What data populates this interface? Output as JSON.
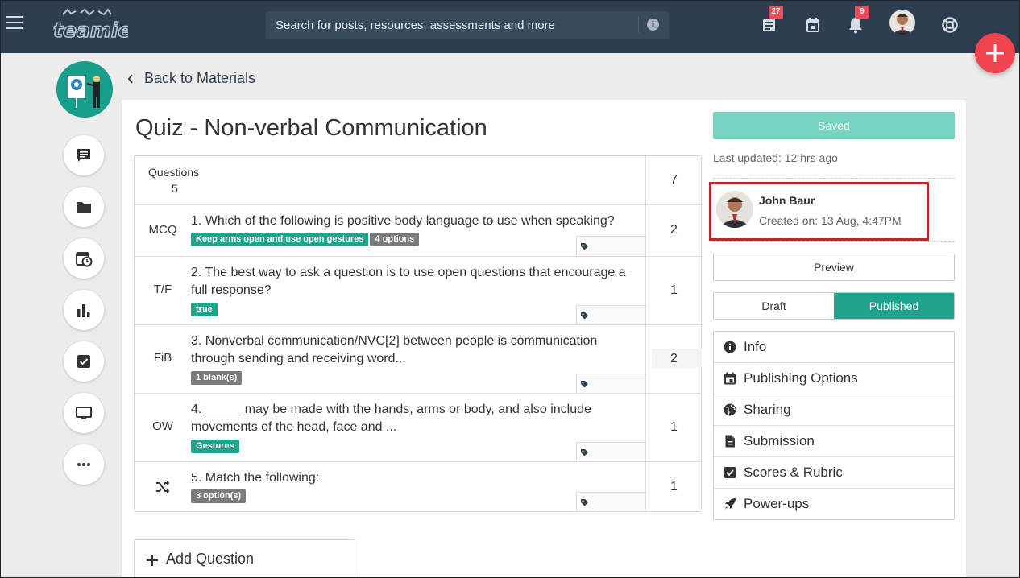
{
  "app": {
    "name": "teamie"
  },
  "topbar": {
    "search_placeholder": "Search for posts, resources, assessments and more",
    "info_glyph": "i",
    "newsfeed_badge": "27",
    "notifications_badge": "9",
    "icons": [
      "menu-icon",
      "newsfeed-icon",
      "calendar-icon",
      "bell-icon",
      "help-icon"
    ]
  },
  "nav": {
    "back_label": "Back to Materials"
  },
  "rail": {
    "items": [
      "discussions-icon",
      "folder-icon",
      "schedule-icon",
      "analytics-icon",
      "assessment-icon",
      "display-icon",
      "more-icon"
    ]
  },
  "quiz": {
    "title": "Quiz - Non-verbal Communication",
    "header": {
      "label": "Questions",
      "count": "5",
      "total_score": "7"
    },
    "questions": [
      {
        "type": "MCQ",
        "text": "1. Which of the following is positive body language to use when speaking?",
        "tags": [
          {
            "text": "Keep arms open and use open gestures",
            "color": "#1fa38c"
          },
          {
            "text": "4 options",
            "color": "#7a7a7a"
          }
        ],
        "score": "2"
      },
      {
        "type": "T/F",
        "text": "2. The best way to ask a question is to use open questions that encourage a full response?",
        "tags": [
          {
            "text": "true",
            "color": "#1fa38c"
          }
        ],
        "score": "1"
      },
      {
        "type": "FiB",
        "text": "3. Nonverbal communication/NVC[2] between people is communication through sending and receiving word...",
        "tags": [
          {
            "text": "1 blank(s)",
            "color": "#7a7a7a"
          }
        ],
        "score": "2"
      },
      {
        "type": "OW",
        "text": "4. _____ may be made with the hands, arms or body, and also include movements of the head, face and ...",
        "tags": [
          {
            "text": "Gestures",
            "color": "#1fa38c"
          }
        ],
        "score": "1"
      },
      {
        "type": "shuffle-icon",
        "text": "5. Match the following:",
        "tags": [
          {
            "text": "3 option(s)",
            "color": "#7a7a7a"
          }
        ],
        "score": "1"
      }
    ],
    "add_question": "Add Question"
  },
  "sidebar": {
    "saved_label": "Saved",
    "last_updated": "Last updated: 12 hrs ago",
    "author": {
      "name": "John Baur",
      "created": "Created on: 13 Aug, 4:47PM"
    },
    "preview_label": "Preview",
    "status": {
      "draft": "Draft",
      "published": "Published",
      "selected": "Published"
    },
    "menu": [
      {
        "label": "Info",
        "icon": "info-icon"
      },
      {
        "label": "Publishing Options",
        "icon": "calendar-icon"
      },
      {
        "label": "Sharing",
        "icon": "globe-icon"
      },
      {
        "label": "Submission",
        "icon": "document-icon"
      },
      {
        "label": "Scores & Rubric",
        "icon": "checkbox-icon"
      },
      {
        "label": "Power-ups",
        "icon": "rocket-icon"
      }
    ]
  },
  "colors": {
    "topbar": "#2c3e50",
    "accent": "#1fa38c",
    "saved": "#77d4c0",
    "fab": "#f0454f",
    "badge": "#e74c5a",
    "highlight": "#b22a2a"
  }
}
